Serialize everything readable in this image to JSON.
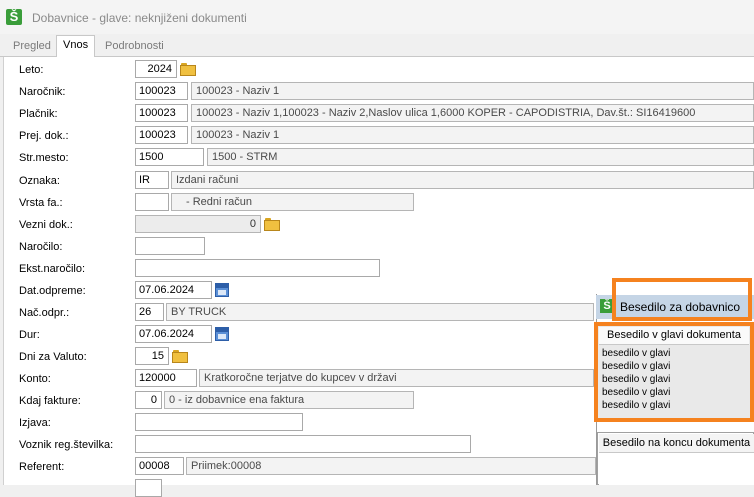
{
  "window": {
    "title": "Dobavnice - glave: neknjiženi dokumenti",
    "app_icon": "Š"
  },
  "tabs": [
    {
      "label": "Pregled"
    },
    {
      "label": "Vnos"
    },
    {
      "label": "Podrobnosti"
    }
  ],
  "fields": {
    "leto": {
      "label": "Leto:",
      "value": "2024"
    },
    "narocnik": {
      "label": "Naročnik:",
      "code": "100023",
      "desc": "100023 - Naziv 1"
    },
    "placnik": {
      "label": "Plačnik:",
      "code": "100023",
      "desc": "100023 - Naziv 1,100023 - Naziv 2,Naslov ulica 1,6000 KOPER - CAPODISTRIA, Dav.št.: SI16419600"
    },
    "prej_dok": {
      "label": "Prej. dok.:",
      "code": "100023",
      "desc": "100023 - Naziv 1"
    },
    "str_mesto": {
      "label": "Str.mesto:",
      "code": "1500",
      "desc": "1500 - STRM"
    },
    "oznaka": {
      "label": "Oznaka:",
      "code": "IR",
      "desc": "Izdani računi"
    },
    "vrsta_fa": {
      "label": "Vrsta fa.:",
      "code": "",
      "desc": "- Redni račun"
    },
    "vezni_dok": {
      "label": "Vezni dok.:",
      "value": "0"
    },
    "narocilo": {
      "label": "Naročilo:",
      "value": ""
    },
    "ekst_narocilo": {
      "label": "Ekst.naročilo:",
      "value": ""
    },
    "dat_odpreme": {
      "label": "Dat.odpreme:",
      "value": "07.06.2024"
    },
    "nac_odpr": {
      "label": "Nač.odpr.:",
      "code": "26",
      "desc": "BY TRUCK"
    },
    "dur": {
      "label": "Dur:",
      "value": "07.06.2024"
    },
    "dni_za_valuto": {
      "label": "Dni za Valuto:",
      "value": "15"
    },
    "konto": {
      "label": "Konto:",
      "code": "120000",
      "desc": "Kratkoročne terjatve do kupcev v državi"
    },
    "kdaj_fakture": {
      "label": "Kdaj fakture:",
      "code": "0",
      "desc": "0 - iz dobavnice ena faktura"
    },
    "izjava": {
      "label": "Izjava:",
      "value": ""
    },
    "voznik": {
      "label": "Voznik reg.številka:",
      "value": ""
    },
    "referent": {
      "label": "Referent:",
      "code": "00008",
      "desc": "Priimek:00008"
    }
  },
  "popup": {
    "title": "Besedilo za dobavnico",
    "header_section": {
      "title": "Besedilo v glavi dokumenta",
      "lines": [
        "besedilo v glavi",
        "besedilo v glavi",
        "besedilo v glavi",
        "besedilo v glavi",
        "besedilo v glavi"
      ]
    },
    "footer_section": {
      "title": "Besedilo na koncu dokumenta"
    }
  },
  "colors": {
    "highlight": "#f5821f",
    "popup_header": "#c5d5e6",
    "brand": "#3a9d3a"
  }
}
